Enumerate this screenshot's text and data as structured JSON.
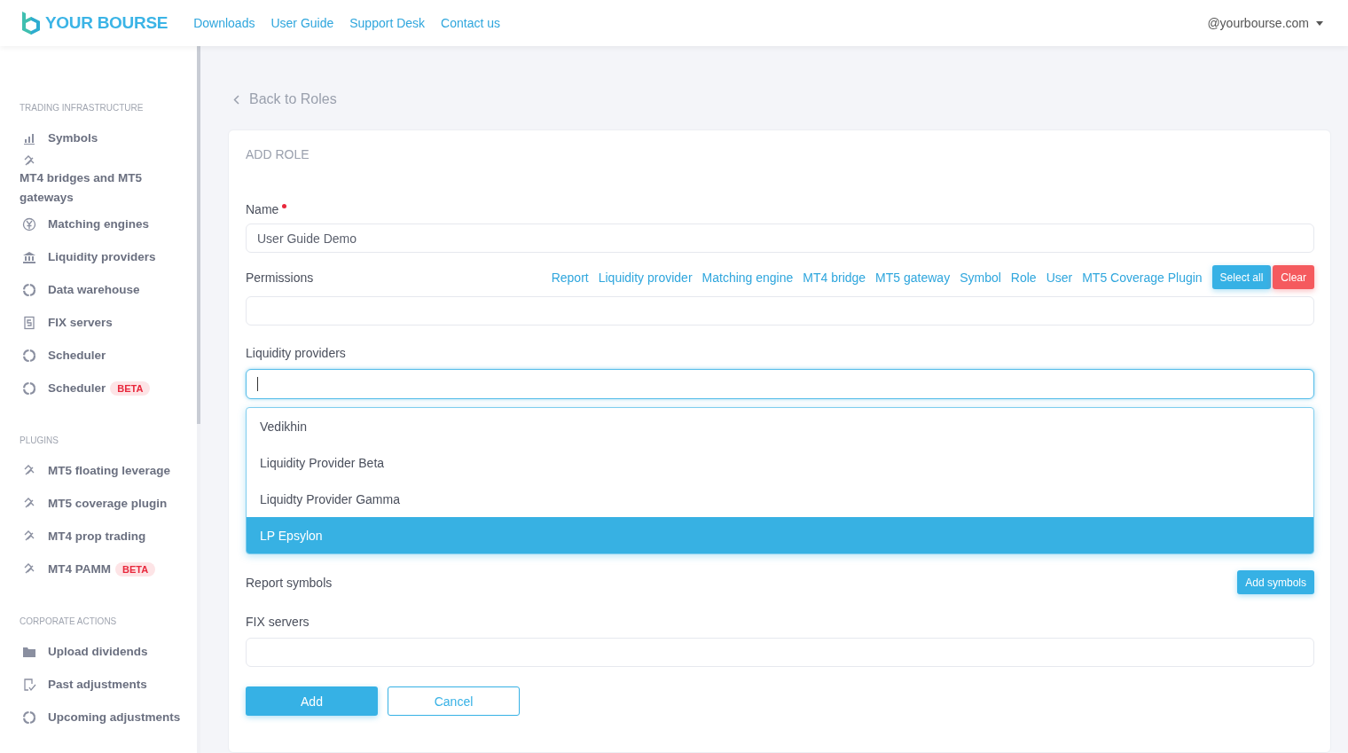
{
  "header": {
    "logo": "YOUR BOURSE",
    "nav": [
      "Downloads",
      "User Guide",
      "Support Desk",
      "Contact us"
    ],
    "user": "@yourbourse.com"
  },
  "sidebar": {
    "sections": [
      {
        "title": "TRADING INFRASTRUCTURE",
        "items": [
          {
            "label": "Symbols",
            "kind": "chart"
          },
          {
            "label": "MT4 bridges and MT5 gateways",
            "kind": "link"
          },
          {
            "label": "Matching engines",
            "kind": "yen"
          },
          {
            "label": "Liquidity providers",
            "kind": "bank"
          },
          {
            "label": "Data warehouse",
            "kind": "ring"
          },
          {
            "label": "FIX servers",
            "kind": "doc"
          },
          {
            "label": "Scheduler",
            "kind": "ring"
          },
          {
            "label": "Scheduler",
            "kind": "ring",
            "badge": "BETA"
          }
        ]
      },
      {
        "title": "PLUGINS",
        "items": [
          {
            "label": "MT5 floating leverage",
            "kind": "link"
          },
          {
            "label": "MT5 coverage plugin",
            "kind": "link"
          },
          {
            "label": "MT4 prop trading",
            "kind": "link"
          },
          {
            "label": "MT4 PAMM",
            "kind": "link",
            "badge": "BETA"
          }
        ]
      },
      {
        "title": "CORPORATE ACTIONS",
        "items": [
          {
            "label": "Upload dividends",
            "kind": "folder"
          },
          {
            "label": "Past adjustments",
            "kind": "check"
          },
          {
            "label": "Upcoming adjustments",
            "kind": "ring"
          }
        ]
      }
    ]
  },
  "back_link": "Back to Roles",
  "card": {
    "title": "ADD ROLE",
    "name": {
      "label": "Name",
      "required": true,
      "value": "User Guide Demo"
    },
    "permissions": {
      "label": "Permissions",
      "shortcuts": [
        "Report",
        "Liquidity provider",
        "Matching engine",
        "MT4 bridge",
        "MT5 gateway",
        "Symbol",
        "Role",
        "User",
        "MT5 Coverage Plugin"
      ],
      "select_all": "Select all",
      "clear": "Clear"
    },
    "liquidity_providers": {
      "label": "Liquidity providers",
      "focused": true,
      "options": [
        {
          "label": "Vedikhin",
          "selected": false
        },
        {
          "label": "Liquidity Provider Beta",
          "selected": false
        },
        {
          "label": "Liquidty Provider Gamma",
          "selected": false
        },
        {
          "label": "LP Epsylon",
          "selected": true
        }
      ]
    },
    "report_symbols": {
      "label": "Report symbols",
      "button": "Add symbols"
    },
    "fix_servers": {
      "label": "FIX servers"
    },
    "add": "Add",
    "cancel": "Cancel"
  }
}
